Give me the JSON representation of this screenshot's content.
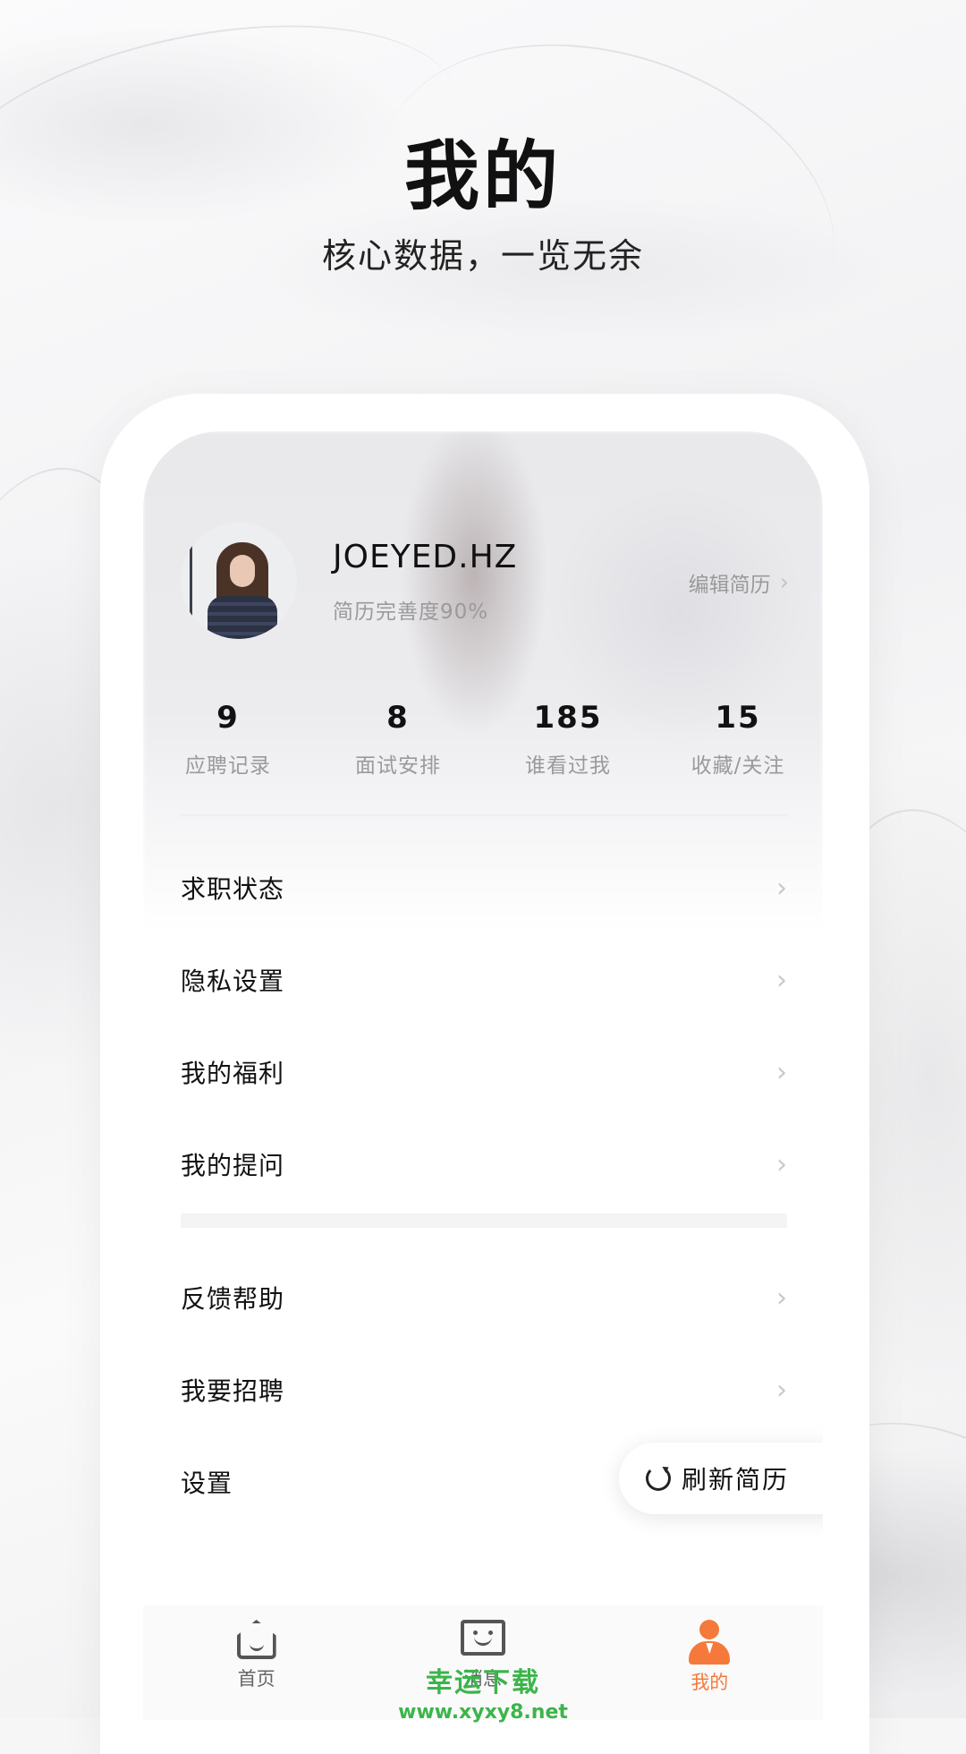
{
  "hero": {
    "title": "我的",
    "subtitle": "核心数据，一览无余"
  },
  "profile": {
    "name": "JOEYED.HZ",
    "resume_completion": "简历完善度90%",
    "edit_resume_label": "编辑简历"
  },
  "stats": [
    {
      "value": "9",
      "label": "应聘记录"
    },
    {
      "value": "8",
      "label": "面试安排"
    },
    {
      "value": "185",
      "label": "谁看过我"
    },
    {
      "value": "15",
      "label": "收藏/关注"
    }
  ],
  "menu_group1": [
    {
      "label": "求职状态"
    },
    {
      "label": "隐私设置"
    },
    {
      "label": "我的福利"
    },
    {
      "label": "我的提问"
    }
  ],
  "menu_group2": [
    {
      "label": "反馈帮助"
    },
    {
      "label": "我要招聘"
    },
    {
      "label": "设置"
    }
  ],
  "refresh_button": {
    "label": "刷新简历"
  },
  "tabbar": {
    "tabs": [
      {
        "label": "首页",
        "icon": "home-icon"
      },
      {
        "label": "消息",
        "icon": "message-icon"
      },
      {
        "label": "我的",
        "icon": "profile-icon",
        "active": true
      }
    ],
    "active_color": "#f5793a"
  },
  "watermark": {
    "text": "幸运下载",
    "url": "www.xyxy8.net"
  }
}
